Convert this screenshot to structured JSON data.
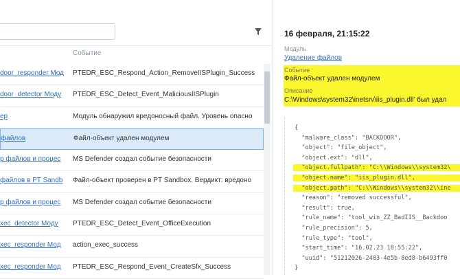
{
  "events_table": {
    "header": {
      "module": "",
      "event": "Событие"
    },
    "rows": [
      {
        "module": "door_responder Мод",
        "event": "PTEDR_ESC_Respond_Action_RemoveIISPlugin_Success"
      },
      {
        "module": "door_detector Моду",
        "event": "PTEDR_ESC_Detect_Event_MaliciousIISPlugin"
      },
      {
        "module": "ер",
        "event": "Модуль обнаружил вредоносный файл. Уровень опасно"
      },
      {
        "module": "файлов",
        "event": "Файл-объект удален модулем",
        "selected": true
      },
      {
        "module": "р файлов и процес",
        "event": "MS Defender создал событие безопасности"
      },
      {
        "module": "файлов в PT Sandb",
        "event": "Файл-объект проверен в PT Sandbox. Вердикт: вредоно"
      },
      {
        "module": "р файлов и процес",
        "event": "MS Defender создал событие безопасности"
      },
      {
        "module": "xec_detector Моду",
        "event": "PTEDR_ESC_Detect_Event_OfficeExecution"
      },
      {
        "module": "xec_responder Мод",
        "event": "action_exec_success"
      },
      {
        "module": "xec_responder Мод",
        "event": "PTEDR_ESC_Respond_Event_CreateSfx_Success"
      }
    ]
  },
  "details": {
    "title": "16 февраля, 21:15:22",
    "module_label": "Модуль",
    "module_value": "Удаление файлов",
    "event_label": "Событие",
    "event_value": "Файл-объект удален модулем",
    "description_label": "Описание",
    "description_value": "C:\\Windows\\system32\\inetsrv\\iis_plugin.dll' был удал",
    "json_lines": [
      {
        "text": "{",
        "highlight": false
      },
      {
        "text": "  \"malware_class\": \"BACKDOOR\",",
        "highlight": false
      },
      {
        "text": "  \"object\": \"file_object\",",
        "highlight": false
      },
      {
        "text": "  \"object.ext\": \"dll\",",
        "highlight": false
      },
      {
        "text": "  \"object.fullpath\": \"C:\\\\Windows\\\\system32\\",
        "highlight": true
      },
      {
        "text": "  \"object.name\": \"iis_plugin.dll\",",
        "highlight": true
      },
      {
        "text": "  \"object.path\": \"C:\\\\Windows\\\\system32\\\\ine",
        "highlight": true
      },
      {
        "text": "  \"reason\": \"removed successful\",",
        "highlight": false
      },
      {
        "text": "  \"result\": true,",
        "highlight": false
      },
      {
        "text": "  \"rule_name\": \"tool_win_ZZ_BadIIS__Backdoo",
        "highlight": false
      },
      {
        "text": "  \"rule_precision\": 5,",
        "highlight": false
      },
      {
        "text": "  \"rule_type\": \"tool\",",
        "highlight": false
      },
      {
        "text": "  \"start_time\": \"16.02.23 18:55:22\",",
        "highlight": false
      },
      {
        "text": "  \"uuid\": \"51212026-2483-4e5b-8ed8-b6493ff0",
        "highlight": false
      },
      {
        "text": "}",
        "highlight": false
      }
    ]
  },
  "colors": {
    "link": "#2f6fbf",
    "highlight": "#fbf72e",
    "selected_row": "#dbeaf8"
  }
}
